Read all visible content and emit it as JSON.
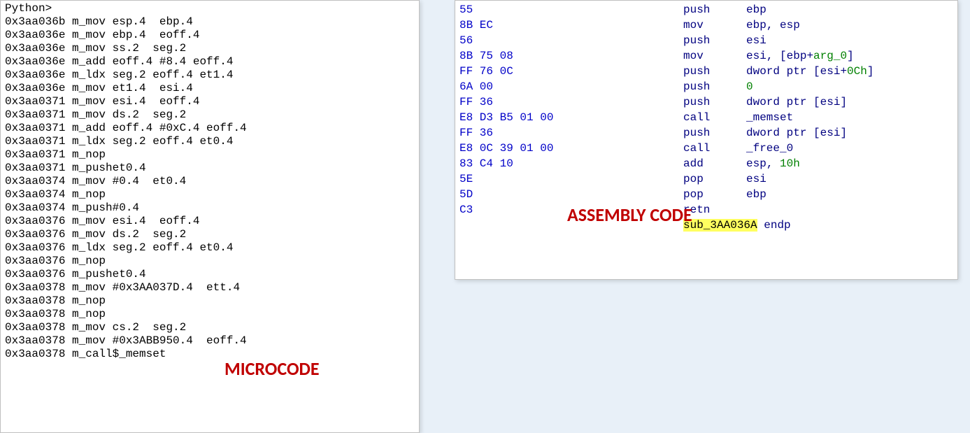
{
  "left": {
    "prompt": "Python>",
    "label": "MICROCODE",
    "lines": [
      {
        "addr": "0x3aa036b",
        "op": "m_mov",
        "args": "esp.4  ebp.4"
      },
      {
        "addr": "0x3aa036e",
        "op": "m_mov",
        "args": "ebp.4  eoff.4"
      },
      {
        "addr": "0x3aa036e",
        "op": "m_mov",
        "args": "ss.2  seg.2"
      },
      {
        "addr": "0x3aa036e",
        "op": "m_add",
        "args": "eoff.4 #8.4 eoff.4"
      },
      {
        "addr": "0x3aa036e",
        "op": "m_ldx",
        "args": "seg.2 eoff.4 et1.4"
      },
      {
        "addr": "0x3aa036e",
        "op": "m_mov",
        "args": "et1.4  esi.4"
      },
      {
        "addr": "0x3aa0371",
        "op": "m_mov",
        "args": "esi.4  eoff.4"
      },
      {
        "addr": "0x3aa0371",
        "op": "m_mov",
        "args": "ds.2  seg.2"
      },
      {
        "addr": "0x3aa0371",
        "op": "m_add",
        "args": "eoff.4 #0xC.4 eoff.4"
      },
      {
        "addr": "0x3aa0371",
        "op": "m_ldx",
        "args": "seg.2 eoff.4 et0.4"
      },
      {
        "addr": "0x3aa0371",
        "op": "m_nop",
        "args": ""
      },
      {
        "addr": "0x3aa0371",
        "op": "m_push",
        "args": "et0.4"
      },
      {
        "addr": "0x3aa0374",
        "op": "m_mov",
        "args": "#0.4  et0.4"
      },
      {
        "addr": "0x3aa0374",
        "op": "m_nop",
        "args": ""
      },
      {
        "addr": "0x3aa0374",
        "op": "m_push",
        "args": "#0.4"
      },
      {
        "addr": "0x3aa0376",
        "op": "m_mov",
        "args": "esi.4  eoff.4"
      },
      {
        "addr": "0x3aa0376",
        "op": "m_mov",
        "args": "ds.2  seg.2"
      },
      {
        "addr": "0x3aa0376",
        "op": "m_ldx",
        "args": "seg.2 eoff.4 et0.4"
      },
      {
        "addr": "0x3aa0376",
        "op": "m_nop",
        "args": ""
      },
      {
        "addr": "0x3aa0376",
        "op": "m_push",
        "args": "et0.4"
      },
      {
        "addr": "0x3aa0378",
        "op": "m_mov",
        "args": "#0x3AA037D.4  ett.4"
      },
      {
        "addr": "0x3aa0378",
        "op": "m_nop",
        "args": ""
      },
      {
        "addr": "0x3aa0378",
        "op": "m_nop",
        "args": ""
      },
      {
        "addr": "0x3aa0378",
        "op": "m_mov",
        "args": "cs.2  seg.2"
      },
      {
        "addr": "0x3aa0378",
        "op": "m_mov",
        "args": "#0x3ABB950.4  eoff.4"
      },
      {
        "addr": "0x3aa0378",
        "op": "m_call",
        "args": "$_memset"
      }
    ]
  },
  "right": {
    "label": "ASSEMBLY CODE",
    "lines": [
      {
        "hex": "55",
        "mnem": "push",
        "oper": [
          {
            "t": "reg",
            "v": "ebp"
          }
        ]
      },
      {
        "hex": "8B EC",
        "mnem": "mov",
        "oper": [
          {
            "t": "reg",
            "v": "ebp"
          },
          {
            "t": "txt",
            "v": ", "
          },
          {
            "t": "reg",
            "v": "esp"
          }
        ]
      },
      {
        "hex": "56",
        "mnem": "push",
        "oper": [
          {
            "t": "reg",
            "v": "esi"
          }
        ]
      },
      {
        "hex": "8B 75 08",
        "mnem": "mov",
        "oper": [
          {
            "t": "reg",
            "v": "esi"
          },
          {
            "t": "txt",
            "v": ", ["
          },
          {
            "t": "reg",
            "v": "ebp"
          },
          {
            "t": "txt",
            "v": "+"
          },
          {
            "t": "num",
            "v": "arg_0"
          },
          {
            "t": "txt",
            "v": "]"
          }
        ]
      },
      {
        "hex": "FF 76 0C",
        "mnem": "push",
        "oper": [
          {
            "t": "kw",
            "v": "dword ptr "
          },
          {
            "t": "txt",
            "v": "["
          },
          {
            "t": "reg",
            "v": "esi"
          },
          {
            "t": "txt",
            "v": "+"
          },
          {
            "t": "num",
            "v": "0Ch"
          },
          {
            "t": "txt",
            "v": "]"
          }
        ]
      },
      {
        "hex": "6A 00",
        "mnem": "push",
        "oper": [
          {
            "t": "num",
            "v": "0"
          }
        ]
      },
      {
        "hex": "FF 36",
        "mnem": "push",
        "oper": [
          {
            "t": "kw",
            "v": "dword ptr "
          },
          {
            "t": "txt",
            "v": "["
          },
          {
            "t": "reg",
            "v": "esi"
          },
          {
            "t": "txt",
            "v": "]"
          }
        ]
      },
      {
        "hex": "E8 D3 B5 01 00",
        "mnem": "call",
        "oper": [
          {
            "t": "sym",
            "v": "_memset"
          }
        ]
      },
      {
        "hex": "FF 36",
        "mnem": "push",
        "oper": [
          {
            "t": "kw",
            "v": "dword ptr "
          },
          {
            "t": "txt",
            "v": "["
          },
          {
            "t": "reg",
            "v": "esi"
          },
          {
            "t": "txt",
            "v": "]"
          }
        ]
      },
      {
        "hex": "E8 0C 39 01 00",
        "mnem": "call",
        "oper": [
          {
            "t": "sym",
            "v": "_free_0"
          }
        ]
      },
      {
        "hex": "83 C4 10",
        "mnem": "add",
        "oper": [
          {
            "t": "reg",
            "v": "esp"
          },
          {
            "t": "txt",
            "v": ", "
          },
          {
            "t": "num",
            "v": "10h"
          }
        ]
      },
      {
        "hex": "5E",
        "mnem": "pop",
        "oper": [
          {
            "t": "reg",
            "v": "esi"
          }
        ]
      },
      {
        "hex": "5D",
        "mnem": "pop",
        "oper": [
          {
            "t": "reg",
            "v": "ebp"
          }
        ]
      },
      {
        "hex": "C3",
        "mnem": "retn",
        "oper": []
      }
    ],
    "endp": {
      "sub": "sub_3AA036A",
      "kw": "endp"
    }
  }
}
